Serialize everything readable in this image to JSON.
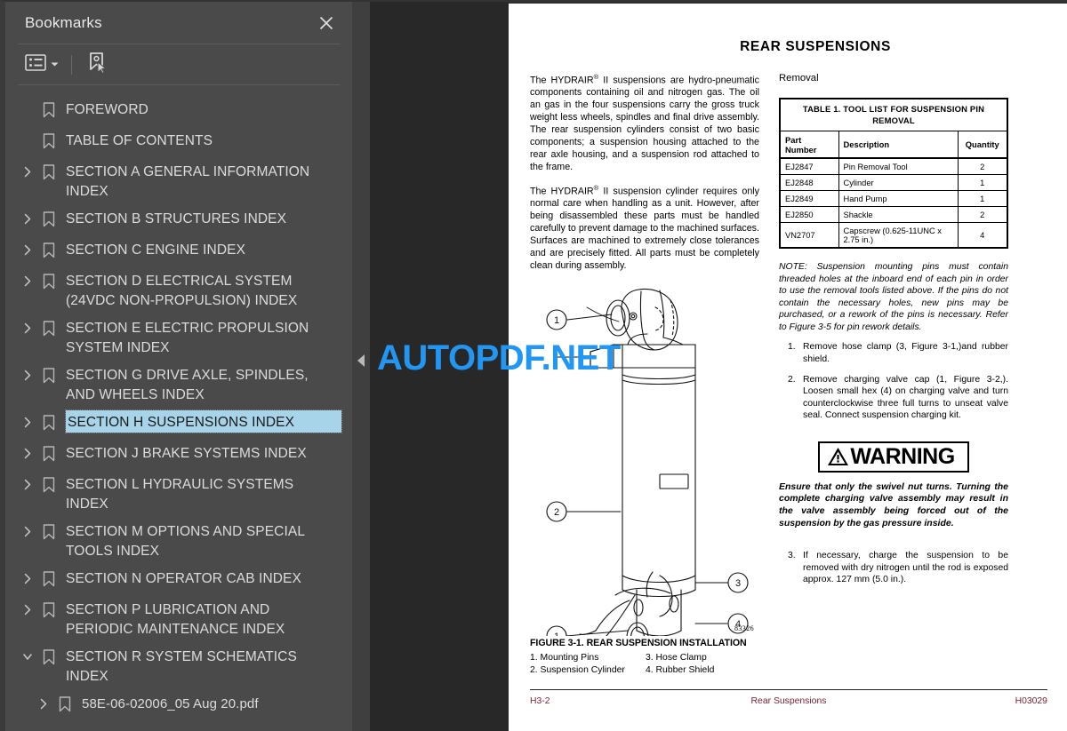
{
  "bookmarks_panel": {
    "title": "Bookmarks",
    "close_icon": "close-icon",
    "toolbar": {
      "list_options_icon": "list-options-icon",
      "dropdown_icon": "chevron-down-icon",
      "select_bookmark_icon": "bookmark-pointer-icon"
    },
    "items": [
      {
        "label": "FOREWORD",
        "expandable": false,
        "expanded": false,
        "selected": false,
        "child": false
      },
      {
        "label": "TABLE OF CONTENTS",
        "expandable": false,
        "expanded": false,
        "selected": false,
        "child": false
      },
      {
        "label": "SECTION A GENERAL INFORMATION INDEX",
        "expandable": true,
        "expanded": false,
        "selected": false,
        "child": false
      },
      {
        "label": "SECTION B STRUCTURES INDEX",
        "expandable": true,
        "expanded": false,
        "selected": false,
        "child": false
      },
      {
        "label": "SECTION C ENGINE INDEX",
        "expandable": true,
        "expanded": false,
        "selected": false,
        "child": false
      },
      {
        "label": "SECTION D ELECTRICAL SYSTEM (24VDC NON-PROPULSION) INDEX",
        "expandable": true,
        "expanded": false,
        "selected": false,
        "child": false
      },
      {
        "label": "SECTION E ELECTRIC PROPULSION SYSTEM INDEX",
        "expandable": true,
        "expanded": false,
        "selected": false,
        "child": false
      },
      {
        "label": "SECTION G DRIVE AXLE, SPINDLES, AND WHEELS INDEX",
        "expandable": true,
        "expanded": false,
        "selected": false,
        "child": false
      },
      {
        "label": "SECTION H SUSPENSIONS INDEX",
        "expandable": true,
        "expanded": false,
        "selected": true,
        "child": false
      },
      {
        "label": "SECTION J BRAKE SYSTEMS INDEX",
        "expandable": true,
        "expanded": false,
        "selected": false,
        "child": false
      },
      {
        "label": "SECTION L HYDRAULIC SYSTEMS INDEX",
        "expandable": true,
        "expanded": false,
        "selected": false,
        "child": false
      },
      {
        "label": "SECTION M OPTIONS AND SPECIAL TOOLS INDEX",
        "expandable": true,
        "expanded": false,
        "selected": false,
        "child": false
      },
      {
        "label": "SECTION N OPERATOR CAB INDEX",
        "expandable": true,
        "expanded": false,
        "selected": false,
        "child": false
      },
      {
        "label": "SECTION P LUBRICATION AND PERIODIC MAINTENANCE INDEX",
        "expandable": true,
        "expanded": false,
        "selected": false,
        "child": false
      },
      {
        "label": "SECTION R SYSTEM SCHEMATICS INDEX",
        "expandable": true,
        "expanded": true,
        "selected": false,
        "child": false
      },
      {
        "label": "58E-06-02006_05 Aug 20.pdf",
        "expandable": true,
        "expanded": false,
        "selected": false,
        "child": true
      }
    ],
    "selection_color": "#a8d4ea",
    "panel_color": "#4a4a4a"
  },
  "splitter": {
    "collapse_icon": "collapse-left-icon"
  },
  "watermark": {
    "text": "AUTOPDF.NET",
    "color": "#2196f3"
  },
  "document": {
    "title": "REAR SUSPENSIONS",
    "left_column": {
      "paragraph_1_pre": "The HYDRAIR",
      "paragraph_1_sup": "®",
      "paragraph_1_post": " II suspensions are hydro-pneumatic components containing oil and nitrogen gas. The oil an gas in the four suspensions carry the gross truck weight less wheels, spindles and final drive assembly. The rear suspension cylinders consist of two basic components; a suspension housing attached to the rear axle housing, and a suspension rod attached to the frame.",
      "paragraph_2_pre": "The HYDRAIR",
      "paragraph_2_sup": "®",
      "paragraph_2_post": " II suspension cylinder requires only normal care when handling as a unit. However, after being disassembled these parts must be handled carefully to prevent damage to the machined surfaces. Surfaces are machined to extremely close tolerances and are precisely fitted. All parts must be completely clean during assembly."
    },
    "figure": {
      "drawing_number": "83326",
      "caption": "FIGURE 3-1. REAR SUSPENSION INSTALLATION",
      "legend_left": [
        "1. Mounting Pins",
        "2. Suspension Cylinder"
      ],
      "legend_right": [
        "3. Hose Clamp",
        "4. Rubber Shield"
      ],
      "callouts": [
        "1",
        "2",
        "3",
        "4",
        "1"
      ]
    },
    "right_column": {
      "section_heading": "Removal",
      "table": {
        "caption": "TABLE 1.  TOOL LIST FOR SUSPENSION PIN REMOVAL",
        "headers": [
          "Part Number",
          "Description",
          "Quantity"
        ],
        "rows": [
          [
            "EJ2847",
            "Pin Removal Tool",
            "2"
          ],
          [
            "EJ2848",
            "Cylinder",
            "1"
          ],
          [
            "EJ2849",
            "Hand Pump",
            "1"
          ],
          [
            "EJ2850",
            "Shackle",
            "2"
          ],
          [
            "VN2707",
            "Capscrew (0.625-11UNC x 2.75 in.)",
            "4"
          ]
        ]
      },
      "note": "NOTE: Suspension mounting pins must contain threaded holes at the inboard end of each pin in order to use the removal tools listed above. If the pins do not contain the necessary holes, new pins may be purchased, or a rework of the pins is necessary. Refer to Figure 3-5 for pin rework details.",
      "steps": [
        {
          "num": "1.",
          "text": "Remove hose clamp (3, Figure 3-1,)and rubber shield."
        },
        {
          "num": "2.",
          "text": "Remove charging valve cap (1, Figure 3-2,). Loosen small hex (4) on charging valve and turn counterclockwise three full turns to unseat valve seal. Connect suspension charging kit."
        }
      ],
      "warning": {
        "label": "WARNING",
        "icon": "warning-triangle-icon",
        "text": "Ensure that only the swivel nut turns. Turning the complete charging valve assembly may result in the valve assembly being forced out of the suspension by the gas pressure inside."
      },
      "steps_after_warning": [
        {
          "num": "3.",
          "text": "If necessary, charge the suspension to be removed with dry nitrogen until the rod is exposed approx. 127 mm (5.0 in.)."
        }
      ]
    },
    "footer": {
      "left": "H3-2",
      "center": "Rear Suspensions",
      "right": "H03029",
      "color": "#7a2230"
    }
  }
}
